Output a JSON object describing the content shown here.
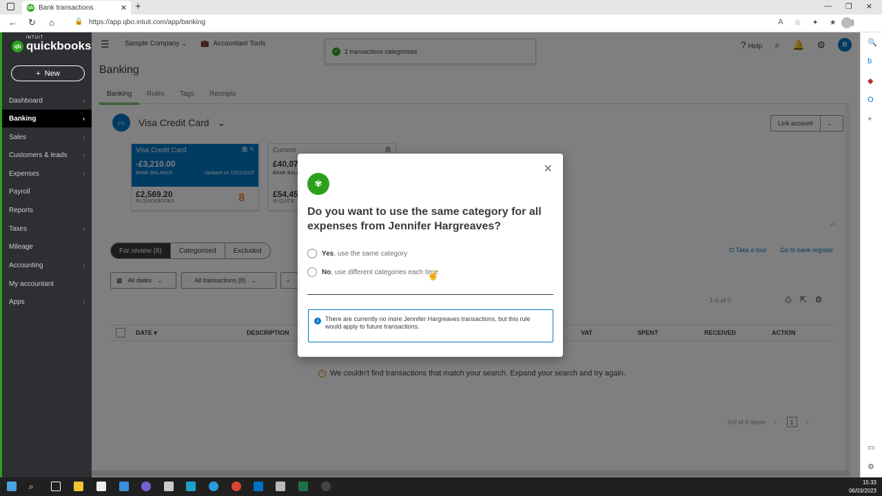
{
  "browser": {
    "tab_title": "Bank transactions",
    "url": "https://app.qbo.intuit.com/app/banking"
  },
  "sidebar": {
    "logo_small": "INTUIT",
    "logo": "quickbooks",
    "new_label": "New",
    "items": [
      {
        "label": "Dashboard"
      },
      {
        "label": "Banking"
      },
      {
        "label": "Sales"
      },
      {
        "label": "Customers & leads"
      },
      {
        "label": "Expenses"
      },
      {
        "label": "Payroll"
      },
      {
        "label": "Reports"
      },
      {
        "label": "Taxes"
      },
      {
        "label": "Mileage"
      },
      {
        "label": "Accounting"
      },
      {
        "label": "My accountant"
      },
      {
        "label": "Apps"
      }
    ]
  },
  "topbar": {
    "company": "Sample Company",
    "accountant_tools": "Accountant Tools",
    "toast": "2 transactions categorised",
    "help": "Help",
    "avatar": "R"
  },
  "page": {
    "title": "Banking",
    "tabs": [
      "Banking",
      "Rules",
      "Tags",
      "Receipts"
    ],
    "account": "Visa Credit Card",
    "link_account": "Link account",
    "cards": [
      {
        "name": "Visa Credit Card",
        "bank_balance": "-£3,210.00",
        "bank_label": "BANK BALANCE",
        "updated": "Updated on 12/11/2022",
        "qb_balance": "£2,569.20",
        "qb_label": "IN QUICKBOOKS",
        "count": "8"
      },
      {
        "name": "Current",
        "bank_balance": "£40,07",
        "bank_label": "BANK BALA",
        "qb_balance": "£54,45",
        "qb_label": "IN QUICK"
      }
    ],
    "segments": [
      "For review (8)",
      "Categorised",
      "Excluded"
    ],
    "take_tour": "Take a tour",
    "go_register": "Go to bank register",
    "filter_dates": "All dates",
    "filter_txn": "All transactions (8)",
    "pager_top": "1-0 of 0",
    "columns": [
      "DATE",
      "DESCRIPTION",
      "VAT",
      "SPENT",
      "RECEIVED",
      "ACTION"
    ],
    "empty_msg": "We couldn't find transactions that match your search. Expand your search and try again.",
    "pager_bottom": "0-0 of 0 items",
    "page_num": "1"
  },
  "modal": {
    "question": "Do you want to use the same category for all expenses from Jennifer Hargreaves?",
    "yes_bold": "Yes",
    "yes_rest": ", use the same category",
    "no_bold": "No",
    "no_rest": ", use different categories each time",
    "info": "There are currently no more Jennifer Hargreaves transactions, but this rule would apply to future transactions."
  },
  "clock": {
    "time": "15:33",
    "date": "06/03/2023"
  },
  "colors": {
    "brand_green": "#2ca01c",
    "link_blue": "#0077c5",
    "sidebar_bg": "#2d2f33"
  }
}
